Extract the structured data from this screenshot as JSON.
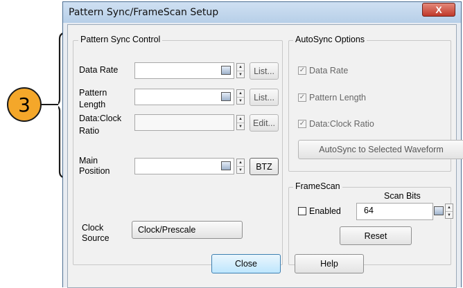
{
  "callout": {
    "number": "3"
  },
  "window": {
    "title": "Pattern Sync/FrameScan Setup",
    "close_glyph": "X"
  },
  "pattern_sync": {
    "legend": "Pattern Sync Control",
    "data_rate": {
      "label": "Data Rate",
      "value": "",
      "button": "List..."
    },
    "pattern_length": {
      "label_line1": "Pattern",
      "label_line2": "Length",
      "value": "",
      "button": "List..."
    },
    "data_clock_ratio": {
      "label_line1": "Data:Clock",
      "label_line2": "Ratio",
      "value": "",
      "button": "Edit..."
    },
    "main_position": {
      "label_line1": "Main",
      "label_line2": "Position",
      "value": "",
      "button": "BTZ"
    },
    "clock_source": {
      "label_line1": "Clock",
      "label_line2": "Source",
      "value": "Clock/Prescale"
    }
  },
  "autosync": {
    "legend": "AutoSync Options",
    "options": [
      {
        "label": "Data Rate",
        "checked": true
      },
      {
        "label": "Pattern Length",
        "checked": true
      },
      {
        "label": "Data:Clock Ratio",
        "checked": true
      }
    ],
    "button": "AutoSync to Selected Waveform"
  },
  "framescan": {
    "legend": "FrameScan",
    "enabled_label": "Enabled",
    "enabled": false,
    "scan_bits_label": "Scan Bits",
    "scan_bits_value": "64",
    "reset_label": "Reset"
  },
  "footer": {
    "close_label": "Close",
    "help_label": "Help"
  },
  "icons": {
    "calculator": "calculator-icon",
    "spin_up": "▲",
    "spin_down": "▼",
    "check": "✓"
  },
  "colors": {
    "callout_fill": "#f4a72a",
    "title_bar": "#b7cfe8",
    "close_button": "#c0392b"
  }
}
